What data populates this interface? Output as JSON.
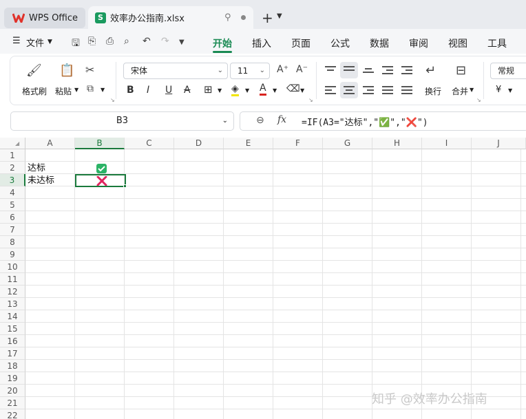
{
  "titlebar": {
    "app_tab": "WPS Office",
    "doc_tab": "效率办公指南.xlsx",
    "doc_icon_letter": "S",
    "new_tab_glyph": "+"
  },
  "menubar": {
    "file_label": "文件",
    "tabs": [
      "开始",
      "插入",
      "页面",
      "公式",
      "数据",
      "审阅",
      "视图",
      "工具"
    ],
    "active_tab": "开始"
  },
  "ribbon": {
    "format_painter": "格式刷",
    "paste": "粘贴",
    "font_name": "宋体",
    "font_size": "11",
    "wrap": "换行",
    "merge": "合并",
    "number_format": "常规",
    "currency_glyph": "¥",
    "bold": "B",
    "italic": "I",
    "underline": "U"
  },
  "formula_bar": {
    "name_box": "B3",
    "fx_label": "fx",
    "formula": "=IF(A3=\"达标\",\"✅\",\"❌\")"
  },
  "sheet": {
    "columns": [
      "A",
      "B",
      "C",
      "D",
      "E",
      "F",
      "G",
      "H",
      "I",
      "J"
    ],
    "active_column": "B",
    "active_row": "3",
    "rows": [
      "1",
      "2",
      "3",
      "4",
      "5",
      "6",
      "7",
      "8",
      "9",
      "10",
      "11",
      "12",
      "13",
      "14",
      "15",
      "16",
      "17",
      "18",
      "19",
      "20",
      "21",
      "22"
    ],
    "cells": {
      "A2": "达标",
      "A3": "未达标",
      "B2": "✅",
      "B3": "❌"
    }
  },
  "watermark": "知乎 @效率办公指南",
  "colors": {
    "accent": "#1a8a54",
    "check_green": "#2bb366",
    "cross_red": "#e0245e"
  }
}
